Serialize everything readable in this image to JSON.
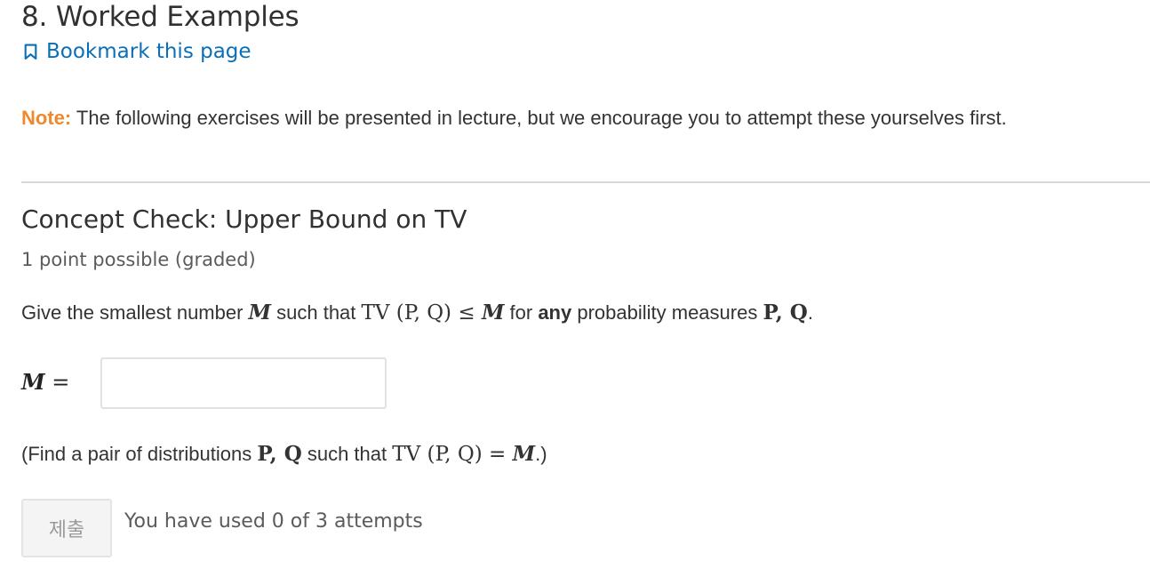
{
  "page": {
    "title": "8. Worked Examples",
    "bookmark_label": "Bookmark this page"
  },
  "note": {
    "label": "Note:",
    "text": " The following exercises will be presented in lecture, but we encourage you to attempt these yourselves first."
  },
  "problem": {
    "title": "Concept Check: Upper Bound on TV",
    "points": "1 point possible (graded)",
    "question_prefix": "Give the smallest number ",
    "question_var": "M",
    "question_mid": " such that ",
    "question_expr": "TV (P, Q) ≤ ",
    "question_var2": "M",
    "question_for": " for ",
    "question_any": "any",
    "question_suffix": " probability measures ",
    "question_measures": "P, Q",
    "question_end": ".",
    "answer_label_var": "M",
    "answer_label_eq": " =",
    "answer_value": "",
    "hint_prefix": "(Find a pair of distributions ",
    "hint_measures": "P, Q",
    "hint_mid": " such that ",
    "hint_expr": "TV (P, Q) = ",
    "hint_var": "M",
    "hint_end": ".)"
  },
  "actions": {
    "submit_label": "제출",
    "attempts_text": "You have used 0 of 3 attempts"
  },
  "colors": {
    "accent_link": "#0a6fb7",
    "note_label": "#f0892e"
  },
  "icons": {
    "bookmark": "bookmark-icon"
  }
}
